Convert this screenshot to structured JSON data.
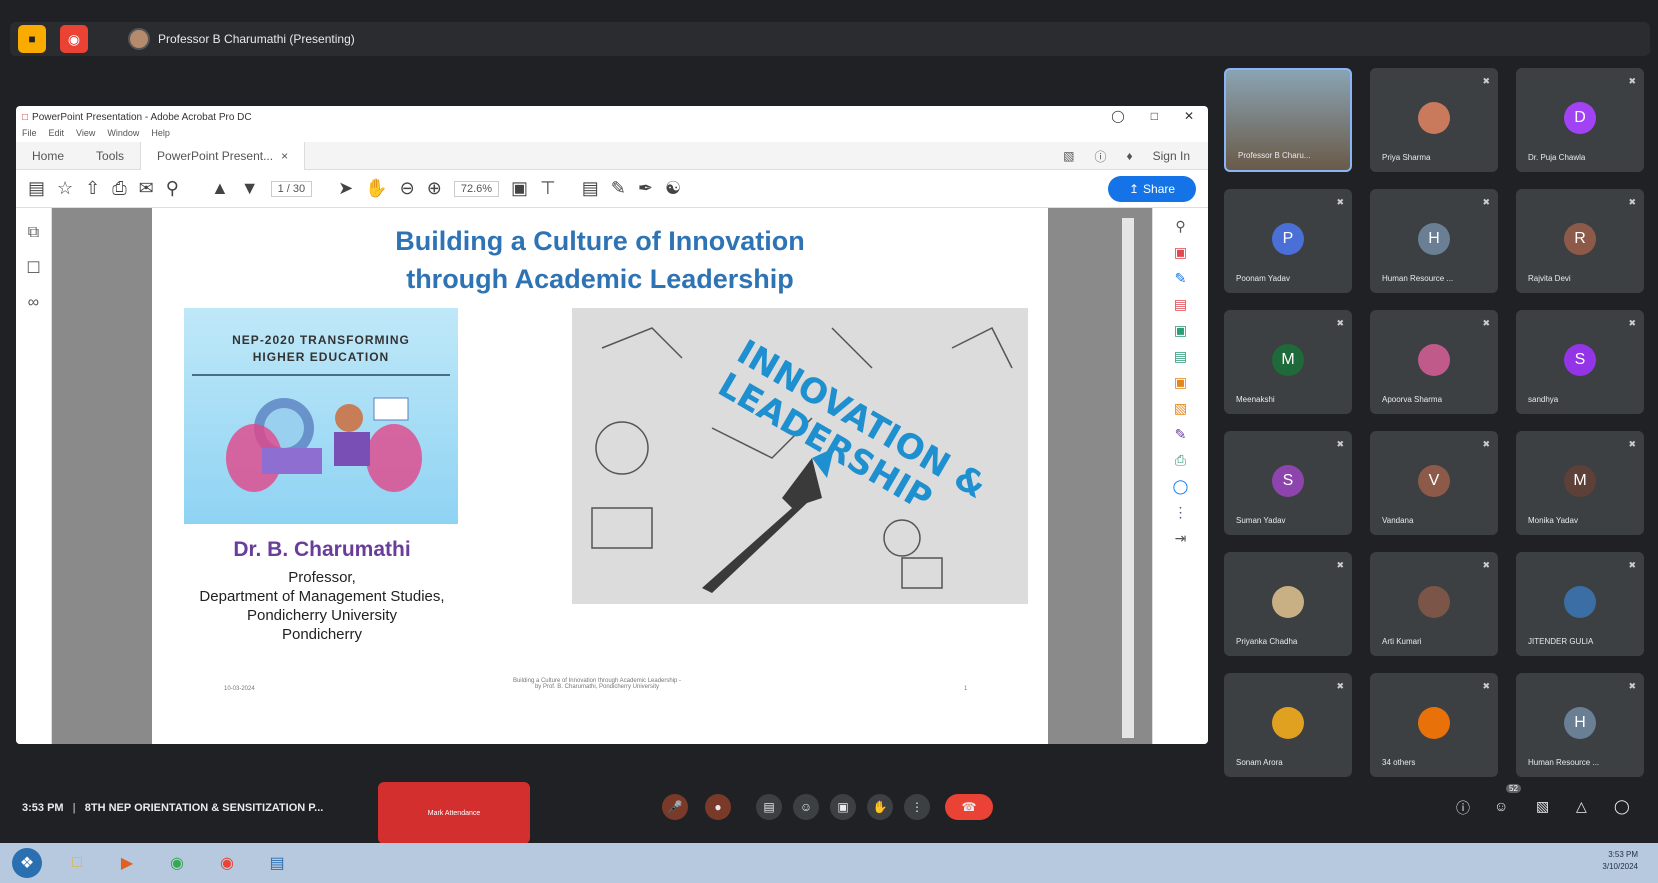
{
  "topbar": {
    "presenter": "Professor B Charumathi (Presenting)"
  },
  "acrobat": {
    "title": "PowerPoint Presentation - Adobe Acrobat Pro DC",
    "menu": [
      "File",
      "Edit",
      "View",
      "Window",
      "Help"
    ],
    "tabs": {
      "home": "Home",
      "tools": "Tools",
      "doc": "PowerPoint Present..."
    },
    "sign_in": "Sign In",
    "page_indicator": "1 / 30",
    "zoom": "72.6%",
    "share": "Share"
  },
  "slide": {
    "title_line1": "Building a Culture of Innovation",
    "title_line2": "through Academic Leadership",
    "nep_line1": "NEP-2020 TRANSFORMING",
    "nep_line2": "HIGHER EDUCATION",
    "innovation_line1": "INNOVATION &",
    "innovation_line2": "LEADERSHIP",
    "author_name": "Dr. B. Charumathi",
    "author_line1": "Professor,",
    "author_line2": "Department of Management Studies,",
    "author_line3": "Pondicherry University",
    "author_line4": "Pondicherry",
    "footer_date": "10-03-2024",
    "footer_center1": "Building a Culture of Innovation through Academic Leadership -",
    "footer_center2": "by Prof. B. Charumathi, Pondicherry University",
    "footer_page": "1"
  },
  "participants": [
    {
      "name": "Professor B Charu...",
      "initial": "",
      "color": ""
    },
    {
      "name": "Priya Sharma",
      "initial": "",
      "color": "#c97a5c"
    },
    {
      "name": "Dr. Puja Chawla",
      "initial": "D",
      "color": "#a142f4"
    },
    {
      "name": "Poonam Yadav",
      "initial": "P",
      "color": "#4a6fd6"
    },
    {
      "name": "Human Resource ...",
      "initial": "H",
      "color": "#6a7f94"
    },
    {
      "name": "Rajvita Devi",
      "initial": "R",
      "color": "#8d5a4a"
    },
    {
      "name": "Meenakshi",
      "initial": "M",
      "color": "#1e6a3a"
    },
    {
      "name": "Apoorva Sharma",
      "initial": "",
      "color": "#c05a8a"
    },
    {
      "name": "sandhya",
      "initial": "S",
      "color": "#9334e6"
    },
    {
      "name": "Suman Yadav",
      "initial": "S",
      "color": "#8e44ad"
    },
    {
      "name": "Vandana",
      "initial": "V",
      "color": "#8d5a4a"
    },
    {
      "name": "Monika Yadav",
      "initial": "M",
      "color": "#5d4037"
    },
    {
      "name": "Priyanka Chadha",
      "initial": "",
      "color": "#c8b084"
    },
    {
      "name": "Arti Kumari",
      "initial": "",
      "color": "#7a5548"
    },
    {
      "name": "JITENDER GULIA",
      "initial": "",
      "color": "#3a6ea5"
    },
    {
      "name": "Sonam Arora",
      "initial": "",
      "color": "#e0a020"
    },
    {
      "name": "34 others",
      "initial": "",
      "color": "#e8710a"
    },
    {
      "name": "Human Resource ...",
      "initial": "H",
      "color": "#6a7f94"
    }
  ],
  "bottom": {
    "time": "3:53 PM",
    "separator": "|",
    "meeting": "8TH NEP ORIENTATION & SENSITIZATION P...",
    "red_button": "Mark Attendance",
    "participants_count": "52"
  },
  "taskbar": {
    "time": "3:53 PM",
    "date": "3/10/2024"
  }
}
